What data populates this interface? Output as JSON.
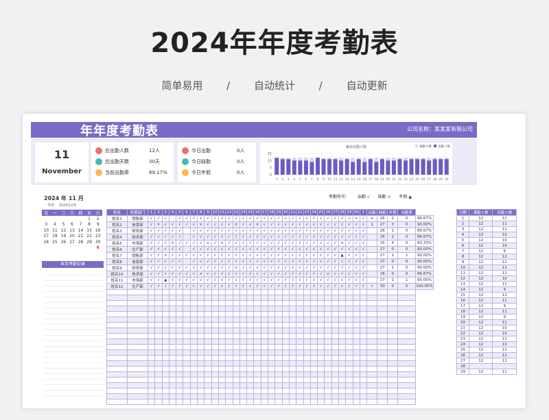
{
  "hero": {
    "title": "2024年年度考勤表",
    "tags": [
      "简单易用",
      "/",
      "自动统计",
      "/",
      "自动更新"
    ]
  },
  "banner": {
    "title": "年年度考勤表",
    "company": "公司名称：某某某有限公司"
  },
  "date_card": {
    "day": "11",
    "month": "November"
  },
  "stats1": [
    {
      "label": "应出勤人数",
      "value": "12人",
      "color": "#e57373"
    },
    {
      "label": "应出勤天数",
      "value": "30天",
      "color": "#4db6ac"
    },
    {
      "label": "当前出勤率",
      "value": "89.17%",
      "color": "#ffb74d"
    }
  ],
  "stats2": [
    {
      "label": "今日出勤",
      "value": "0人",
      "color": "#e57373"
    },
    {
      "label": "今日缺勤",
      "value": "0人",
      "color": "#4db6ac"
    },
    {
      "label": "今日年假",
      "value": "0人",
      "color": "#ffb74d"
    }
  ],
  "chart_data": {
    "type": "bar",
    "title": "每日出勤人数",
    "legend": [
      "满勤人数",
      "出勤人数"
    ],
    "categories": [
      "1",
      "2",
      "3",
      "4",
      "5",
      "6",
      "7",
      "8",
      "9",
      "10",
      "11",
      "12",
      "13",
      "14",
      "15",
      "16",
      "17",
      "18",
      "19",
      "20",
      "21",
      "22",
      "23",
      "24",
      "25",
      "26",
      "27",
      "28",
      "29",
      "30"
    ],
    "series": [
      {
        "name": "满勤人数",
        "values": [
          12,
          12,
          12,
          12,
          12,
          12,
          12,
          12,
          12,
          12,
          12,
          12,
          12,
          12,
          12,
          12,
          12,
          12,
          12,
          12,
          12,
          12,
          12,
          12,
          12,
          12,
          12,
          12,
          12,
          12
        ]
      },
      {
        "name": "出勤人数",
        "values": [
          12,
          11,
          11,
          10,
          10,
          10,
          9,
          12,
          11,
          11,
          11,
          10,
          11,
          9,
          11,
          9,
          11,
          9,
          11,
          10,
          10,
          11,
          10,
          11,
          11,
          11,
          10,
          11,
          11,
          11
        ]
      }
    ],
    "ylim": [
      0,
      15
    ],
    "yticks": [
      0,
      5,
      10,
      15
    ]
  },
  "calendar": {
    "year_label": "2024  年  11  月",
    "today_label": "今日：   2024/12/6",
    "weekdays": [
      "日",
      "一",
      "二",
      "三",
      "四",
      "五",
      "六"
    ],
    "rows": [
      [
        "",
        "",
        "",
        "",
        "",
        "1",
        "2"
      ],
      [
        "3",
        "4",
        "5",
        "6",
        "7",
        "8",
        "9"
      ],
      [
        "10",
        "11",
        "12",
        "13",
        "14",
        "15",
        "16"
      ],
      [
        "17",
        "18",
        "19",
        "20",
        "21",
        "22",
        "23"
      ],
      [
        "24",
        "25",
        "26",
        "27",
        "28",
        "29",
        "30"
      ],
      [
        "",
        "",
        "",
        "",
        "",
        "",
        "6"
      ]
    ],
    "notes_title": "本月考勤记录"
  },
  "legend": {
    "label": "考勤符号：",
    "items": [
      "出勤   √",
      "缺勤   ×",
      "年假  ▲"
    ]
  },
  "attendance": {
    "headers": [
      "姓名",
      "所属部门",
      "1",
      "2",
      "3",
      "4",
      "5",
      "6",
      "7",
      "8",
      "9",
      "10",
      "11",
      "12",
      "13",
      "14",
      "15",
      "16",
      "17",
      "18",
      "19",
      "20",
      "21",
      "22",
      "23",
      "24",
      "25",
      "26",
      "27",
      "28",
      "29",
      "30",
      "1",
      "出勤",
      "缺勤",
      "年假",
      "出勤率"
    ],
    "rows": [
      [
        "姓名1",
        "销售部",
        "√",
        "√",
        "√",
        "",
        "√",
        "√",
        "√",
        "√",
        "√",
        "√",
        "√",
        "√",
        "√",
        "√",
        "√",
        "√",
        "√",
        "√",
        "√",
        "√",
        "√",
        "√",
        "√",
        "√",
        "√",
        "√",
        "√",
        "√",
        "√",
        "×",
        "√",
        "×",
        "26",
        "2",
        "0",
        "86.67%"
      ],
      [
        "姓名2",
        "信息部",
        "√",
        "×",
        "√",
        "√",
        "√",
        "√",
        "√",
        "×",
        "√",
        "√",
        "√",
        "√",
        "×",
        "√",
        "√",
        "×",
        "√",
        "√",
        "√",
        "√",
        "√",
        "√",
        "√",
        "√",
        "√",
        "√",
        "√",
        "√",
        "√",
        "√",
        "√",
        "1",
        "27",
        "3",
        "0",
        "90.00%"
      ],
      [
        "姓名3",
        "财务部",
        "√",
        "√",
        "√",
        "√",
        "√",
        "",
        "√",
        "√",
        "√",
        "√",
        "√",
        "√",
        "√",
        "√",
        "√",
        "√",
        "√",
        "√",
        "√",
        "√",
        "√",
        "√",
        "√",
        "√",
        "√",
        "√",
        "√",
        "√",
        "√",
        "√",
        "√",
        "",
        "26",
        "1",
        "0",
        "86.67%"
      ],
      [
        "姓名4",
        "技术部",
        "√",
        "√",
        "√",
        "√",
        "√",
        "",
        "√",
        "√",
        "√",
        "√",
        "√",
        "√",
        "√",
        "√",
        "√",
        "√",
        "√",
        "√",
        "√",
        "√",
        "√",
        "√",
        "√",
        "√",
        "√",
        "√",
        "√",
        "√",
        "√",
        "√",
        "√",
        "",
        "26",
        "2",
        "0",
        "86.67%"
      ],
      [
        "姓名5",
        "市场部",
        "√",
        "√",
        "√",
        "×",
        "√",
        "√",
        "√",
        "√",
        "×",
        "√",
        "×",
        "√",
        "√",
        "√",
        "√",
        "√",
        "√",
        "√",
        "√",
        "√",
        "√",
        "√",
        "√",
        "√",
        "√",
        "√",
        "√",
        "×",
        "√",
        "√",
        "√",
        "",
        "25",
        "4",
        "0",
        "83.33%"
      ],
      [
        "姓名6",
        "生产部",
        "√",
        "√",
        "√",
        "√",
        "√",
        "",
        "√",
        "√",
        "√",
        "√",
        "√",
        "√",
        "√",
        "√",
        "√",
        "√",
        "√",
        "√",
        "√",
        "√",
        "√",
        "√",
        "√",
        "√",
        "√",
        "√",
        "√",
        "√",
        "√",
        "√",
        "√",
        "",
        "27",
        "0",
        "0",
        "90.00%"
      ],
      [
        "姓名7",
        "销售部",
        "√",
        "√",
        "×",
        "√",
        "√",
        "√",
        "√",
        "√",
        "√",
        "√",
        "√",
        "√",
        "√",
        "√",
        "√",
        "√",
        "√",
        "√",
        "√",
        "√",
        "√",
        "√",
        "√",
        "√",
        "√",
        "√",
        "√",
        "▲",
        "√",
        "√",
        "√",
        "",
        "27",
        "1",
        "1",
        "90.00%"
      ],
      [
        "姓名8",
        "信息部",
        "√",
        "√",
        "√",
        "√",
        "√",
        "",
        "√",
        "√",
        "√",
        "√",
        "√",
        "√",
        "√",
        "√",
        "√",
        "√",
        "√",
        "√",
        "√",
        "√",
        "√",
        "√",
        "√",
        "√",
        "√",
        "√",
        "√",
        "√",
        "√",
        "√",
        "√",
        "",
        "27",
        "0",
        "0",
        "90.00%"
      ],
      [
        "姓名9",
        "财务部",
        "√",
        "√",
        "√",
        "√",
        "√",
        "√",
        "√",
        "√",
        "√",
        "√",
        "√",
        "√",
        "×",
        "√",
        "√",
        "√",
        "√",
        "√",
        "√",
        "√",
        "√",
        "√",
        "√",
        "√",
        "√",
        "√",
        "√",
        "√",
        "√",
        "√",
        "√",
        "",
        "27",
        "1",
        "0",
        "90.00%"
      ],
      [
        "姓名10",
        "技术部",
        "√",
        "√",
        "√",
        "√",
        "√",
        "√",
        "√",
        "×",
        "√",
        "√",
        "√",
        "√",
        "√",
        "√",
        "√",
        "√",
        "√",
        "√",
        "√",
        "√",
        "√",
        "√",
        "√",
        "√",
        "√",
        "×",
        "√",
        "√",
        "√",
        "√",
        "√",
        "",
        "26",
        "0",
        "0",
        "86.67%"
      ],
      [
        "姓名11",
        "市场部",
        "√",
        "√",
        "▲",
        "√",
        "√",
        "√",
        "√",
        "√",
        "√",
        "√",
        "√",
        "√",
        "√",
        "√",
        "√",
        "√",
        "√",
        "√",
        "√",
        "√",
        "√",
        "√",
        "√",
        "√",
        "√",
        "√",
        "√",
        "√",
        "√",
        "√",
        "√",
        "",
        "27",
        "1",
        "1",
        "90.00%"
      ],
      [
        "姓名12",
        "生产部",
        "√",
        "√",
        "√",
        "√",
        "√",
        "√",
        "√",
        "√",
        "√",
        "√",
        "√",
        "√",
        "√",
        "√",
        "√",
        "√",
        "√",
        "√",
        "√",
        "√",
        "√",
        "√",
        "√",
        "√",
        "√",
        "√",
        "√",
        "√",
        "√",
        "√",
        "√",
        "√",
        "30",
        "0",
        "0",
        "100.00%"
      ]
    ],
    "empty_rows": 21
  },
  "daily": {
    "headers": [
      "日期",
      "满勤人数",
      "出勤人数"
    ],
    "rows": [
      [
        "1",
        "12",
        "12"
      ],
      [
        "2",
        "12",
        "11"
      ],
      [
        "3",
        "12",
        "11"
      ],
      [
        "4",
        "12",
        "10"
      ],
      [
        "5",
        "12",
        "10"
      ],
      [
        "6",
        "12",
        "10"
      ],
      [
        "7",
        "12",
        "9"
      ],
      [
        "8",
        "12",
        "12"
      ],
      [
        "9",
        "12",
        "11"
      ],
      [
        "10",
        "12",
        "11"
      ],
      [
        "11",
        "12",
        "11"
      ],
      [
        "12",
        "12",
        "10"
      ],
      [
        "13",
        "12",
        "11"
      ],
      [
        "14",
        "12",
        "9"
      ],
      [
        "15",
        "12",
        "11"
      ],
      [
        "16",
        "12",
        "11"
      ],
      [
        "17",
        "12",
        "9"
      ],
      [
        "18",
        "12",
        "11"
      ],
      [
        "19",
        "12",
        "9"
      ],
      [
        "20",
        "12",
        "11"
      ],
      [
        "21",
        "12",
        "10"
      ],
      [
        "22",
        "12",
        "10"
      ],
      [
        "23",
        "12",
        "11"
      ],
      [
        "24",
        "12",
        "12"
      ],
      [
        "25",
        "12",
        "11"
      ],
      [
        "26",
        "12",
        "11"
      ],
      [
        "27",
        "12",
        "11"
      ],
      [
        "28",
        "",
        ""
      ],
      [
        "29",
        "12",
        "11"
      ]
    ]
  }
}
